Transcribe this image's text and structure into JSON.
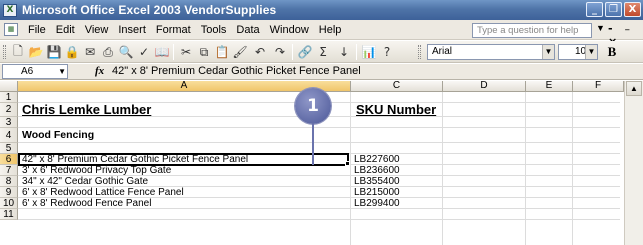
{
  "window": {
    "title": "Microsoft Office Excel 2003 VendorSupplies",
    "minimize": "_",
    "maximize": "❐",
    "close": "X"
  },
  "menu": {
    "items": [
      "File",
      "Edit",
      "View",
      "Insert",
      "Format",
      "Tools",
      "Data",
      "Window",
      "Help"
    ],
    "ask_placeholder": "Type a question for help",
    "doc_controls": "- ₋ ×"
  },
  "toolbar": {
    "font": "Arial",
    "size": "10",
    "bold": "B"
  },
  "formula_bar": {
    "name_box": "A6",
    "fx": "fx",
    "content": "42\" x 8' Premium Cedar Gothic Picket Fence Panel"
  },
  "sheet": {
    "columns": [
      "A",
      "C",
      "D",
      "E",
      "F"
    ],
    "row_numbers": [
      "1",
      "2",
      "3",
      "4",
      "5",
      "6",
      "7",
      "8",
      "9",
      "10",
      "11"
    ],
    "company": "Chris Lemke Lumber",
    "sku_header": "SKU Number",
    "section": "Wood Fencing",
    "rows": [
      {
        "item": "42\" x 8' Premium Cedar Gothic Picket Fence Panel",
        "sku": "LB227600"
      },
      {
        "item": "3' x 6' Redwood Privacy Top Gate",
        "sku": "LB236600"
      },
      {
        "item": "34\" x 42\" Cedar Gothic Gate",
        "sku": "LB355400"
      },
      {
        "item": "6' x 8' Redwood Lattice Fence Panel",
        "sku": "LB215000"
      },
      {
        "item": "6' x 8' Redwood Fence Panel",
        "sku": "LB299400"
      }
    ]
  },
  "callout": {
    "number": "1"
  }
}
